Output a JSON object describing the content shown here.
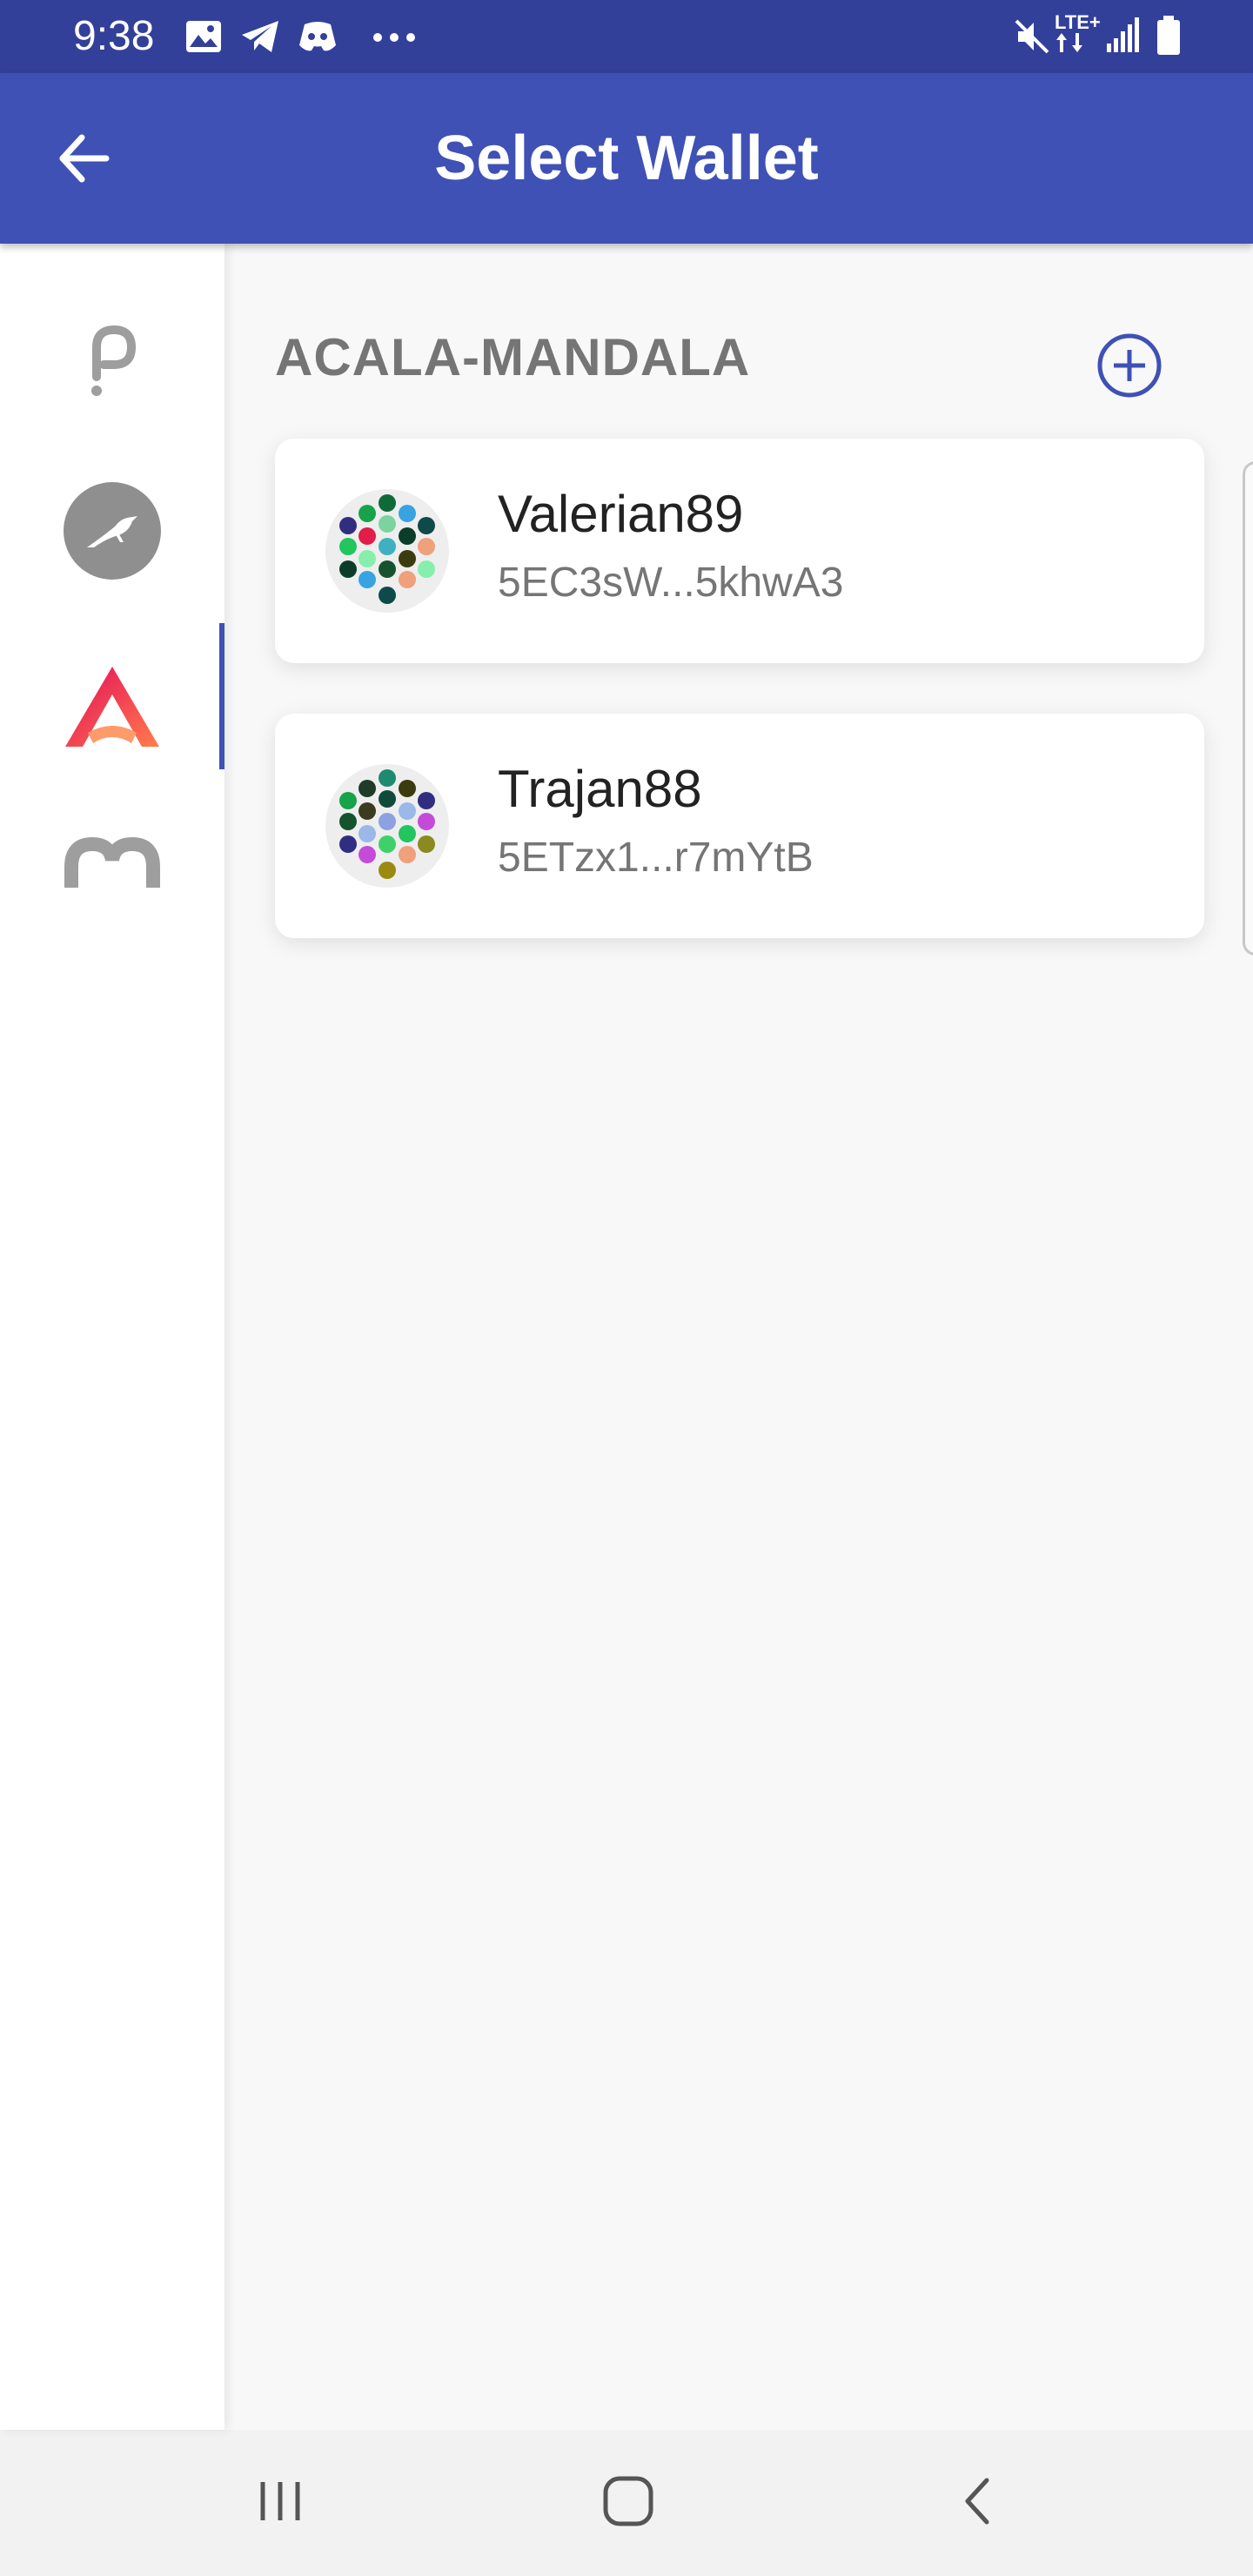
{
  "status_bar": {
    "time": "9:38",
    "left_icons": [
      "image-icon",
      "telegram-icon",
      "discord-icon",
      "more-dots-icon"
    ],
    "right_icons": [
      "mute-icon",
      "lte-icon",
      "signal-icon",
      "battery-icon"
    ],
    "network_label": "LTE+"
  },
  "app_bar": {
    "title": "Select Wallet",
    "back_icon": "arrow-left-icon"
  },
  "sidebar": {
    "networks": [
      {
        "icon": "polkadot-icon",
        "active": false
      },
      {
        "icon": "kusama-icon",
        "active": false
      },
      {
        "icon": "acala-icon",
        "active": true
      },
      {
        "icon": "laminar-icon",
        "active": false
      }
    ]
  },
  "main": {
    "section_title": "ACALA-MANDALA",
    "add_icon": "plus-circle-icon",
    "accounts": [
      {
        "name": "Valerian89",
        "address": "5EC3sW...5khwA3"
      },
      {
        "name": "Trajan88",
        "address": "5ETzx1...r7mYtB"
      }
    ]
  },
  "colors": {
    "primary": "#3f51b5",
    "status_bar": "#32409a",
    "acala_gradient_start": "#e40c5b",
    "acala_gradient_end": "#ff4c3b"
  },
  "nav_bar": {
    "icons": [
      "recent-apps-icon",
      "home-icon",
      "back-icon"
    ]
  }
}
